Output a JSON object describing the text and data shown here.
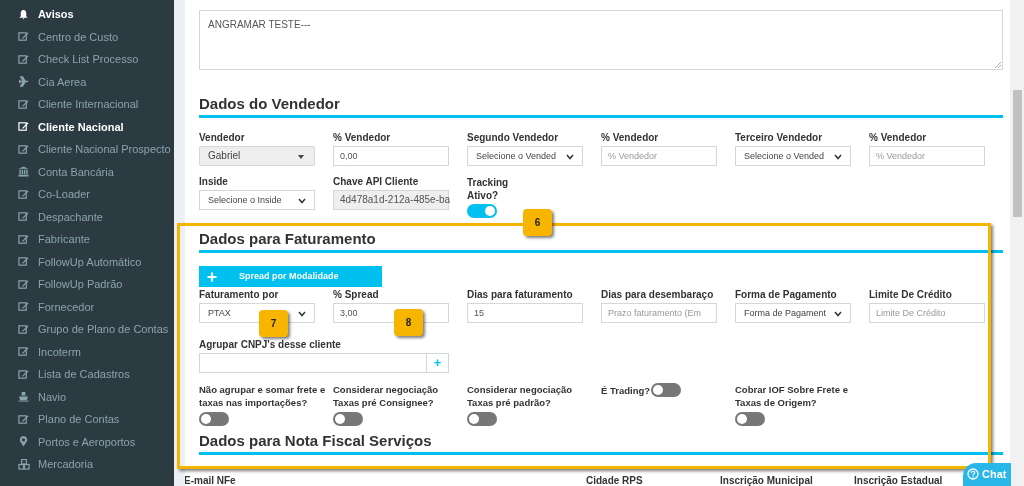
{
  "sidebar": {
    "items": [
      {
        "label": "Avisos",
        "kind": "bell",
        "selected": true
      },
      {
        "label": "Centro de Custo",
        "kind": "edit",
        "selected": false
      },
      {
        "label": "Check List Processo",
        "kind": "edit",
        "selected": false
      },
      {
        "label": "Cia Aerea",
        "kind": "plane",
        "selected": false
      },
      {
        "label": "Cliente Internacional",
        "kind": "edit",
        "selected": false
      },
      {
        "label": "Cliente Nacional",
        "kind": "edit",
        "selected": true
      },
      {
        "label": "Cliente Nacional Prospecto",
        "kind": "edit",
        "selected": false
      },
      {
        "label": "Conta Bancária",
        "kind": "bank",
        "selected": false
      },
      {
        "label": "Co-Loader",
        "kind": "edit",
        "selected": false
      },
      {
        "label": "Despachante",
        "kind": "edit",
        "selected": false
      },
      {
        "label": "Fabricante",
        "kind": "edit",
        "selected": false
      },
      {
        "label": "FollowUp Automático",
        "kind": "edit",
        "selected": false
      },
      {
        "label": "FollowUp Padrão",
        "kind": "edit",
        "selected": false
      },
      {
        "label": "Fornecedor",
        "kind": "edit",
        "selected": false
      },
      {
        "label": "Grupo de Plano de Contas",
        "kind": "edit",
        "selected": false
      },
      {
        "label": "Incoterm",
        "kind": "edit",
        "selected": false
      },
      {
        "label": "Lista de Cadastros",
        "kind": "edit",
        "selected": false
      },
      {
        "label": "Navio",
        "kind": "ship",
        "selected": false
      },
      {
        "label": "Plano de Contas",
        "kind": "edit",
        "selected": false
      },
      {
        "label": "Portos e Aeroportos",
        "kind": "pin",
        "selected": false
      },
      {
        "label": "Mercadoria",
        "kind": "cubes",
        "selected": false
      }
    ]
  },
  "observacoes": {
    "value": "ANGRAMAR TESTE---"
  },
  "vendedor": {
    "title": "Dados do Vendedor",
    "rows": [
      [
        {
          "label": "Vendedor",
          "kind": "combo",
          "value": "Gabriel"
        },
        {
          "label": "% Vendedor",
          "kind": "input",
          "value": "0,00"
        },
        {
          "label": "Segundo Vendedor",
          "kind": "select",
          "value": "Selecione o Vended"
        },
        {
          "label": "% Vendedor",
          "kind": "input",
          "placeholder": "% Vendedor"
        },
        {
          "label": "Terceiro Vendedor",
          "kind": "select",
          "value": "Selecione o Vended"
        },
        {
          "label": "% Vendedor",
          "kind": "input",
          "placeholder": "% Vendedor"
        }
      ],
      [
        {
          "label": "Inside",
          "kind": "select",
          "value": "Selecione o Inside"
        },
        {
          "label": "Chave API Cliente",
          "kind": "readonly",
          "value": "4d478a1d-212a-485e-ba"
        },
        {
          "label": "Tracking Ativo?",
          "kind": "toggle",
          "on": true
        }
      ]
    ]
  },
  "faturamento": {
    "title": "Dados para Faturamento",
    "button": "Spread por Modalidade",
    "fields": [
      {
        "label": "Faturamento por",
        "kind": "select",
        "value": "PTAX"
      },
      {
        "label": "% Spread",
        "kind": "input",
        "value": "3,00"
      },
      {
        "label": "Dias para faturamento",
        "kind": "input",
        "value": "15"
      },
      {
        "label": "Dias para desembaraço",
        "kind": "input",
        "placeholder": "Prazo faturamento (Em"
      },
      {
        "label": "Forma de Pagamento",
        "kind": "select",
        "value": "Forma de Pagament"
      },
      {
        "label": "Limite De Crédito",
        "kind": "input",
        "placeholder": "Limite De Crédito"
      }
    ],
    "agrupar": {
      "label": "Agrupar CNPJ's desse cliente",
      "button": "+"
    },
    "toggles": [
      {
        "label": "Não agrupar e somar frete e taxas nas importações?",
        "kind": "stacked",
        "on": false
      },
      {
        "label": "Considerar negociação Taxas pré Consignee?",
        "kind": "stacked",
        "on": false
      },
      {
        "label": "Considerar negociação Taxas pré padrão?",
        "kind": "stacked",
        "on": false
      },
      {
        "label": "É Trading?",
        "kind": "inline",
        "on": false
      },
      {
        "label": "Cobrar IOF Sobre Frete e Taxas de Origem?",
        "kind": "stacked",
        "on": false
      }
    ]
  },
  "nota_fiscal": {
    "title": "Dados para Nota Fiscal Serviços",
    "left_labels": [
      "E-mail NFe"
    ],
    "right_labels": [
      "Cidade RPS",
      "Inscrição Municipal",
      "Inscrição Estadual"
    ]
  },
  "callouts": [
    "6",
    "7",
    "8"
  ],
  "chat": {
    "label": "Chat"
  }
}
